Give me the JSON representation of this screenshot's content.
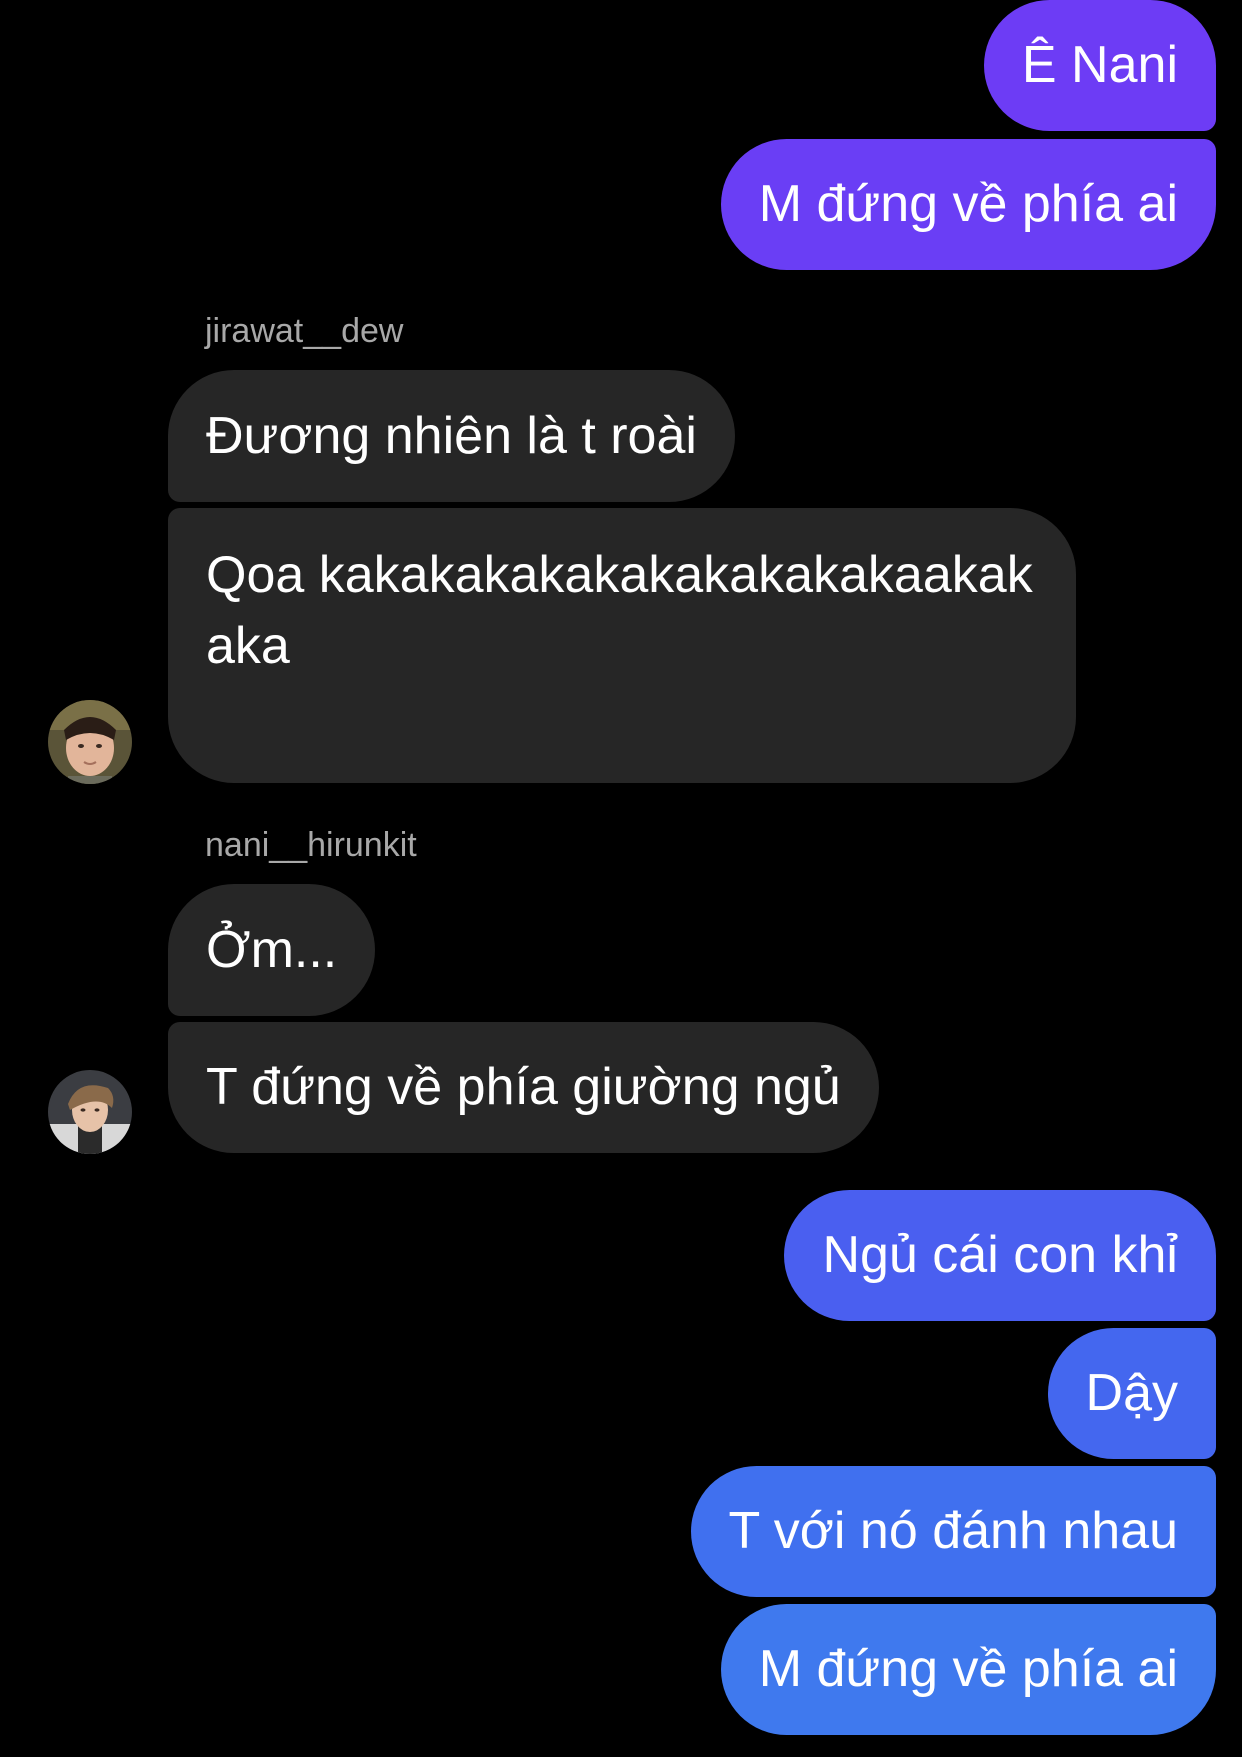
{
  "colors": {
    "background": "#000000",
    "incoming_bubble": "#262626",
    "sender_label": "#a8a8a8",
    "outgoing_gradient": [
      "#6d3cf5",
      "#5a4df2",
      "#4766ee",
      "#3f79ee"
    ]
  },
  "messages_top": [
    {
      "text": "Ê Nani"
    },
    {
      "text": "M đứng về phía ai"
    }
  ],
  "group_dew": {
    "sender": "jirawat__dew",
    "avatar_icon": "profile-avatar-jirawat-icon",
    "messages": [
      {
        "text": "Đương nhiên là t roài"
      },
      {
        "text": "Qoa kakakakakakakakakakakaakakaka"
      }
    ]
  },
  "group_nani": {
    "sender": "nani__hirunkit",
    "avatar_icon": "profile-avatar-nani-icon",
    "messages": [
      {
        "text": "Ởm..."
      },
      {
        "text": "T đứng về phía giường ngủ"
      }
    ]
  },
  "messages_bottom": [
    {
      "text": "Ngủ cái con khỉ"
    },
    {
      "text": "Dậy"
    },
    {
      "text": "T với nó đánh nhau"
    },
    {
      "text": "M đứng về phía ai"
    }
  ]
}
